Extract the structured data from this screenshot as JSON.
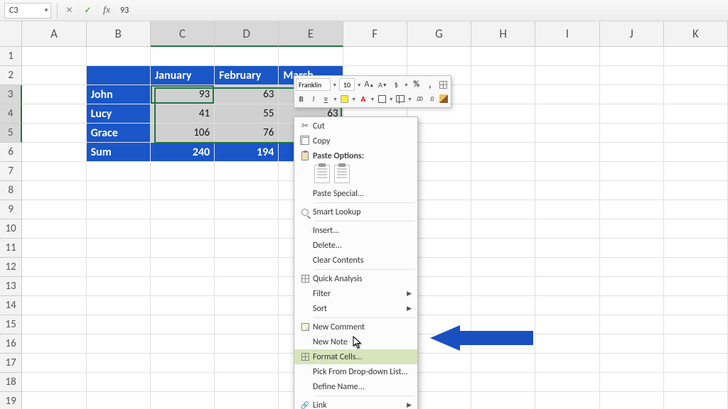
{
  "nameBox": "C3",
  "formulaValue": "93",
  "columns": [
    "A",
    "B",
    "C",
    "D",
    "E",
    "F",
    "G",
    "H",
    "I",
    "J",
    "K"
  ],
  "rowCount": 19,
  "activeCell": "C3",
  "selectionRows": [
    3,
    4,
    5
  ],
  "selectionCols": [
    "C",
    "D",
    "E"
  ],
  "table": {
    "headers": [
      "January",
      "February",
      "March"
    ],
    "rows": [
      {
        "label": "John",
        "values": [
          93,
          63,
          null
        ]
      },
      {
        "label": "Lucy",
        "values": [
          41,
          55,
          63
        ]
      },
      {
        "label": "Grace",
        "values": [
          106,
          76,
          null
        ]
      }
    ],
    "sum": {
      "label": "Sum",
      "values": [
        240,
        194,
        null
      ]
    }
  },
  "miniToolbar": {
    "font": "Franklin",
    "size": "10",
    "increaseFont": "A",
    "decreaseFont": "A",
    "currency": "$",
    "percent": "%",
    "comma": ",",
    "bold": "B",
    "italic": "I",
    "fontColorLetter": "A",
    "decInc": ".00",
    "decDec": ".0"
  },
  "contextMenu": {
    "cut": "Cut",
    "copy": "Copy",
    "pasteOptions": "Paste Options:",
    "pasteSpecial": "Paste Special...",
    "smartLookup": "Smart Lookup",
    "insert": "Insert...",
    "delete": "Delete...",
    "clear": "Clear Contents",
    "quickAnalysis": "Quick Analysis",
    "filter": "Filter",
    "sort": "Sort",
    "newComment": "New Comment",
    "newNote": "New Note",
    "formatCells": "Format Cells...",
    "pickList": "Pick From Drop-down List...",
    "defineName": "Define Name...",
    "link": "Link"
  }
}
